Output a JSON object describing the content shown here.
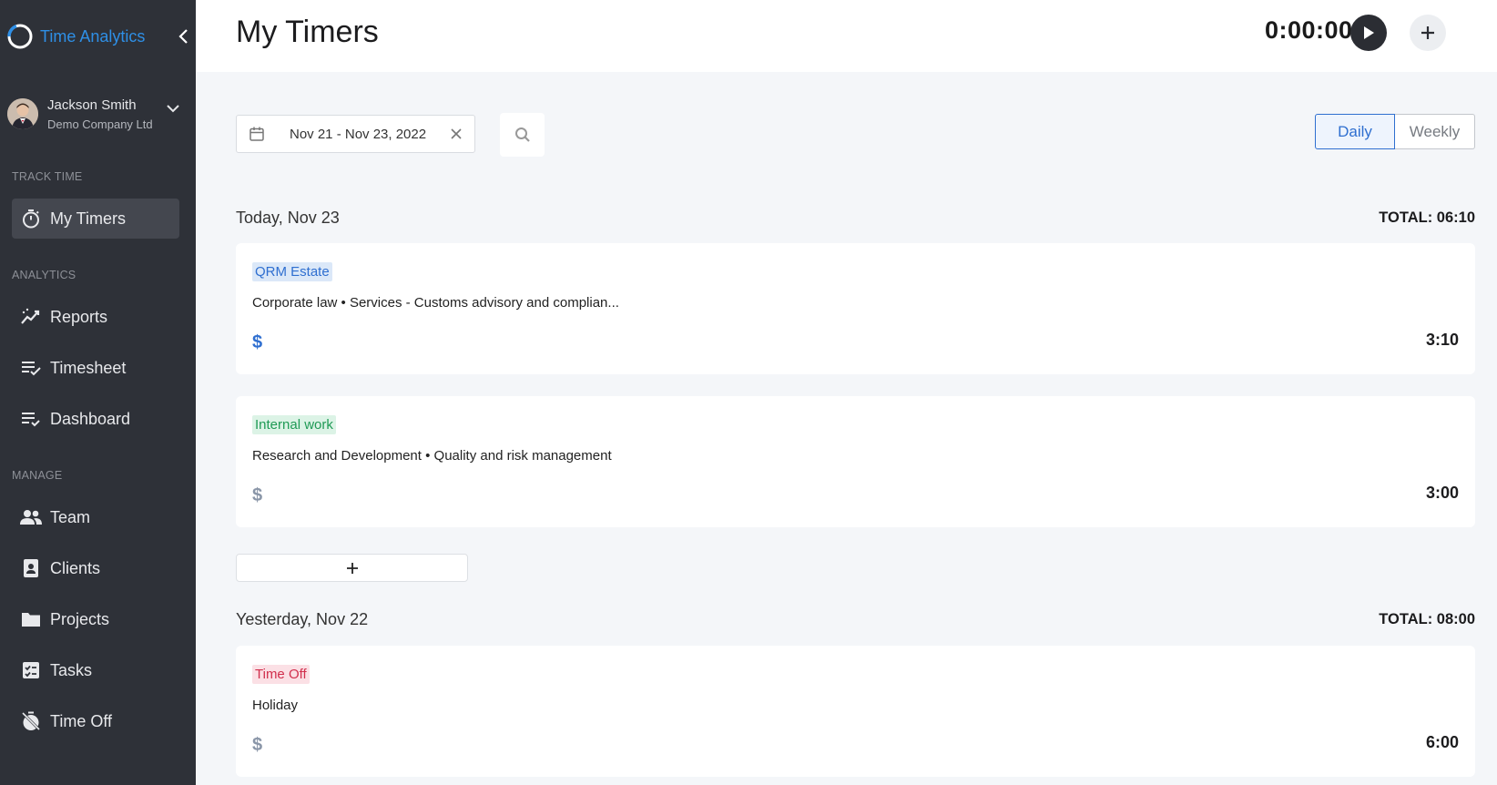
{
  "app": {
    "name": "Time Analytics"
  },
  "user": {
    "name": "Jackson Smith",
    "company": "Demo Company Ltd"
  },
  "sidebar": {
    "sections": [
      {
        "label": "TRACK TIME",
        "items": [
          {
            "label": "My Timers",
            "icon": "stopwatch-icon",
            "active": true
          }
        ]
      },
      {
        "label": "ANALYTICS",
        "items": [
          {
            "label": "Reports",
            "icon": "trend-chart-icon"
          },
          {
            "label": "Timesheet",
            "icon": "list-check-icon"
          },
          {
            "label": "Dashboard",
            "icon": "list-check-icon"
          }
        ]
      },
      {
        "label": "MANAGE",
        "items": [
          {
            "label": "Team",
            "icon": "people-icon"
          },
          {
            "label": "Clients",
            "icon": "contact-card-icon"
          },
          {
            "label": "Projects",
            "icon": "folder-icon"
          },
          {
            "label": "Tasks",
            "icon": "task-list-icon"
          },
          {
            "label": "Time Off",
            "icon": "timer-off-icon"
          }
        ]
      }
    ]
  },
  "header": {
    "title": "My Timers",
    "timer": "0:00:00"
  },
  "filters": {
    "date_range": "Nov 21 - Nov 23, 2022",
    "view": {
      "daily": "Daily",
      "weekly": "Weekly",
      "selected": "Daily"
    }
  },
  "days": [
    {
      "label": "Today, Nov 23",
      "total": "TOTAL: 06:10",
      "entries": [
        {
          "tag": "QRM Estate",
          "tag_color": "#2f6fd0",
          "description": "Corporate law • Services - Customs advisory and complian...",
          "billable": "$",
          "billable_active": true,
          "duration": "3:10"
        },
        {
          "tag": "Internal work",
          "tag_color": "#1f9a55",
          "description": "Research and Development • Quality and risk management",
          "billable": "$",
          "billable_active": false,
          "duration": "3:00"
        }
      ],
      "add_label": "+"
    },
    {
      "label": "Yesterday, Nov 22",
      "total": "TOTAL: 08:00",
      "entries": [
        {
          "tag": "Time Off",
          "tag_color": "#d12f4d",
          "description": "Holiday",
          "billable": "$",
          "billable_active": false,
          "duration": "6:00"
        }
      ]
    }
  ],
  "colors": {
    "sidebar_bg": "#2e3138",
    "accent": "#2f6fd0",
    "page_bg": "#f4f6f9"
  }
}
